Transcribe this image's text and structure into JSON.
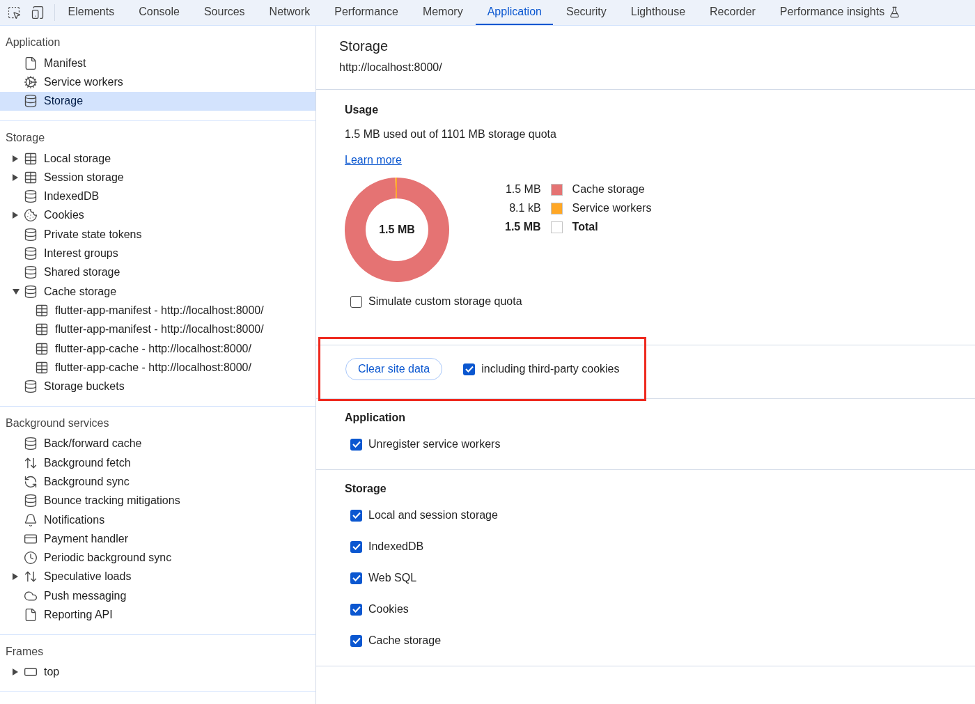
{
  "toolbar": {
    "tabs": [
      {
        "label": "Elements",
        "selected": false
      },
      {
        "label": "Console",
        "selected": false
      },
      {
        "label": "Sources",
        "selected": false
      },
      {
        "label": "Network",
        "selected": false
      },
      {
        "label": "Performance",
        "selected": false
      },
      {
        "label": "Memory",
        "selected": false
      },
      {
        "label": "Application",
        "selected": true
      },
      {
        "label": "Security",
        "selected": false
      },
      {
        "label": "Lighthouse",
        "selected": false
      },
      {
        "label": "Recorder",
        "selected": false
      },
      {
        "label": "Performance insights",
        "selected": false,
        "kind": "experimental"
      }
    ]
  },
  "sidebar": {
    "sections": [
      {
        "title": "Application",
        "items": [
          {
            "label": "Manifest",
            "kind": "document",
            "selected": false
          },
          {
            "label": "Service workers",
            "kind": "gears",
            "selected": false
          },
          {
            "label": "Storage",
            "kind": "database",
            "selected": true
          }
        ]
      },
      {
        "title": "Storage",
        "items": [
          {
            "label": "Local storage",
            "kind": "table",
            "selected": false,
            "expanded": false
          },
          {
            "label": "Session storage",
            "kind": "table",
            "selected": false,
            "expanded": false
          },
          {
            "label": "IndexedDB",
            "kind": "database",
            "selected": false
          },
          {
            "label": "Cookies",
            "kind": "cookie",
            "selected": false,
            "expanded": false
          },
          {
            "label": "Private state tokens",
            "kind": "database",
            "selected": false
          },
          {
            "label": "Interest groups",
            "kind": "database",
            "selected": false
          },
          {
            "label": "Shared storage",
            "kind": "database",
            "selected": false
          },
          {
            "label": "Cache storage",
            "kind": "database",
            "selected": false,
            "expanded": true,
            "children": [
              {
                "label": "flutter-app-manifest - http://localhost:8000/",
                "kind": "table",
                "selected": false
              },
              {
                "label": "flutter-app-manifest - http://localhost:8000/",
                "kind": "table",
                "selected": false
              },
              {
                "label": "flutter-app-cache - http://localhost:8000/",
                "kind": "table",
                "selected": false
              },
              {
                "label": "flutter-app-cache - http://localhost:8000/",
                "kind": "table",
                "selected": false
              }
            ]
          },
          {
            "label": "Storage buckets",
            "kind": "database",
            "selected": false
          }
        ]
      },
      {
        "title": "Background services",
        "items": [
          {
            "label": "Back/forward cache",
            "kind": "database",
            "selected": false
          },
          {
            "label": "Background fetch",
            "kind": "arrows",
            "selected": false
          },
          {
            "label": "Background sync",
            "kind": "sync",
            "selected": false
          },
          {
            "label": "Bounce tracking mitigations",
            "kind": "database",
            "selected": false
          },
          {
            "label": "Notifications",
            "kind": "bell",
            "selected": false
          },
          {
            "label": "Payment handler",
            "kind": "card",
            "selected": false
          },
          {
            "label": "Periodic background sync",
            "kind": "clock",
            "selected": false
          },
          {
            "label": "Speculative loads",
            "kind": "arrows",
            "selected": false,
            "expanded": false
          },
          {
            "label": "Push messaging",
            "kind": "cloud",
            "selected": false
          },
          {
            "label": "Reporting API",
            "kind": "document",
            "selected": false
          }
        ]
      },
      {
        "title": "Frames",
        "items": [
          {
            "label": "top",
            "kind": "frame",
            "selected": false,
            "expanded": false
          }
        ]
      }
    ]
  },
  "main": {
    "title": "Storage",
    "origin": "http://localhost:8000/",
    "usage": {
      "heading": "Usage",
      "summary": "1.5 MB used out of 1101 MB storage quota",
      "link": "Learn more",
      "center_label": "1.5 MB",
      "chart_data": {
        "type": "donut",
        "categories": [
          "Cache storage",
          "Service workers"
        ],
        "values": [
          99.46,
          0.54
        ],
        "colors": [
          "#e57373",
          "#ffa726"
        ]
      },
      "legend": [
        {
          "size": "1.5 MB"
        },
        {
          "size": "8.1 kB"
        }
      ],
      "total": {
        "size": "1.5 MB",
        "label": "Total"
      },
      "simulate": {
        "label": "Simulate custom storage quota",
        "checked": false
      }
    },
    "clear": {
      "button": "Clear site data",
      "highlighted": true,
      "option": {
        "label": "including third-party cookies",
        "checked": true
      }
    },
    "groups": [
      {
        "heading": "Application",
        "options": [
          {
            "label": "Unregister service workers",
            "checked": true
          }
        ]
      },
      {
        "heading": "Storage",
        "options": [
          {
            "label": "Local and session storage",
            "checked": true
          },
          {
            "label": "IndexedDB",
            "checked": true
          },
          {
            "label": "Web SQL",
            "checked": true
          },
          {
            "label": "Cookies",
            "checked": true
          },
          {
            "label": "Cache storage",
            "checked": true
          }
        ]
      }
    ]
  }
}
